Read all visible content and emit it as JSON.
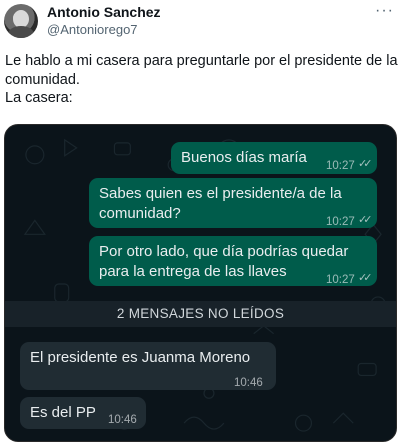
{
  "tweet": {
    "author_name": "Antonio Sanchez",
    "author_handle": "@Antoniorego7",
    "more_label": "···",
    "text_lines": [
      "Le hablo a mi casera para preguntarle por el presidente de la",
      "comunidad.",
      "La casera:"
    ]
  },
  "chat": {
    "outgoing": [
      {
        "lines": [
          "Buenos días maría"
        ],
        "time": "10:27"
      },
      {
        "lines": [
          "Sabes quien es el presidente/a de la",
          "comunidad?"
        ],
        "time": "10:27"
      },
      {
        "lines": [
          "Por otro lado, que día podrías quedar",
          "para la entrega de las llaves"
        ],
        "time": "10:27"
      }
    ],
    "unread_banner": "2 MENSAJES NO LEÍDOS",
    "incoming": [
      {
        "lines": [
          "El presidente es Juanma Moreno"
        ],
        "time": "10:46"
      },
      {
        "lines": [
          "Es del PP"
        ],
        "time": "10:46"
      }
    ],
    "read_receipt_icon": "double-check-icon"
  },
  "colors": {
    "chat_background": "#0b141a",
    "outgoing_bubble": "#005c4b",
    "incoming_bubble": "#202c33",
    "handle_gray": "#536471"
  }
}
